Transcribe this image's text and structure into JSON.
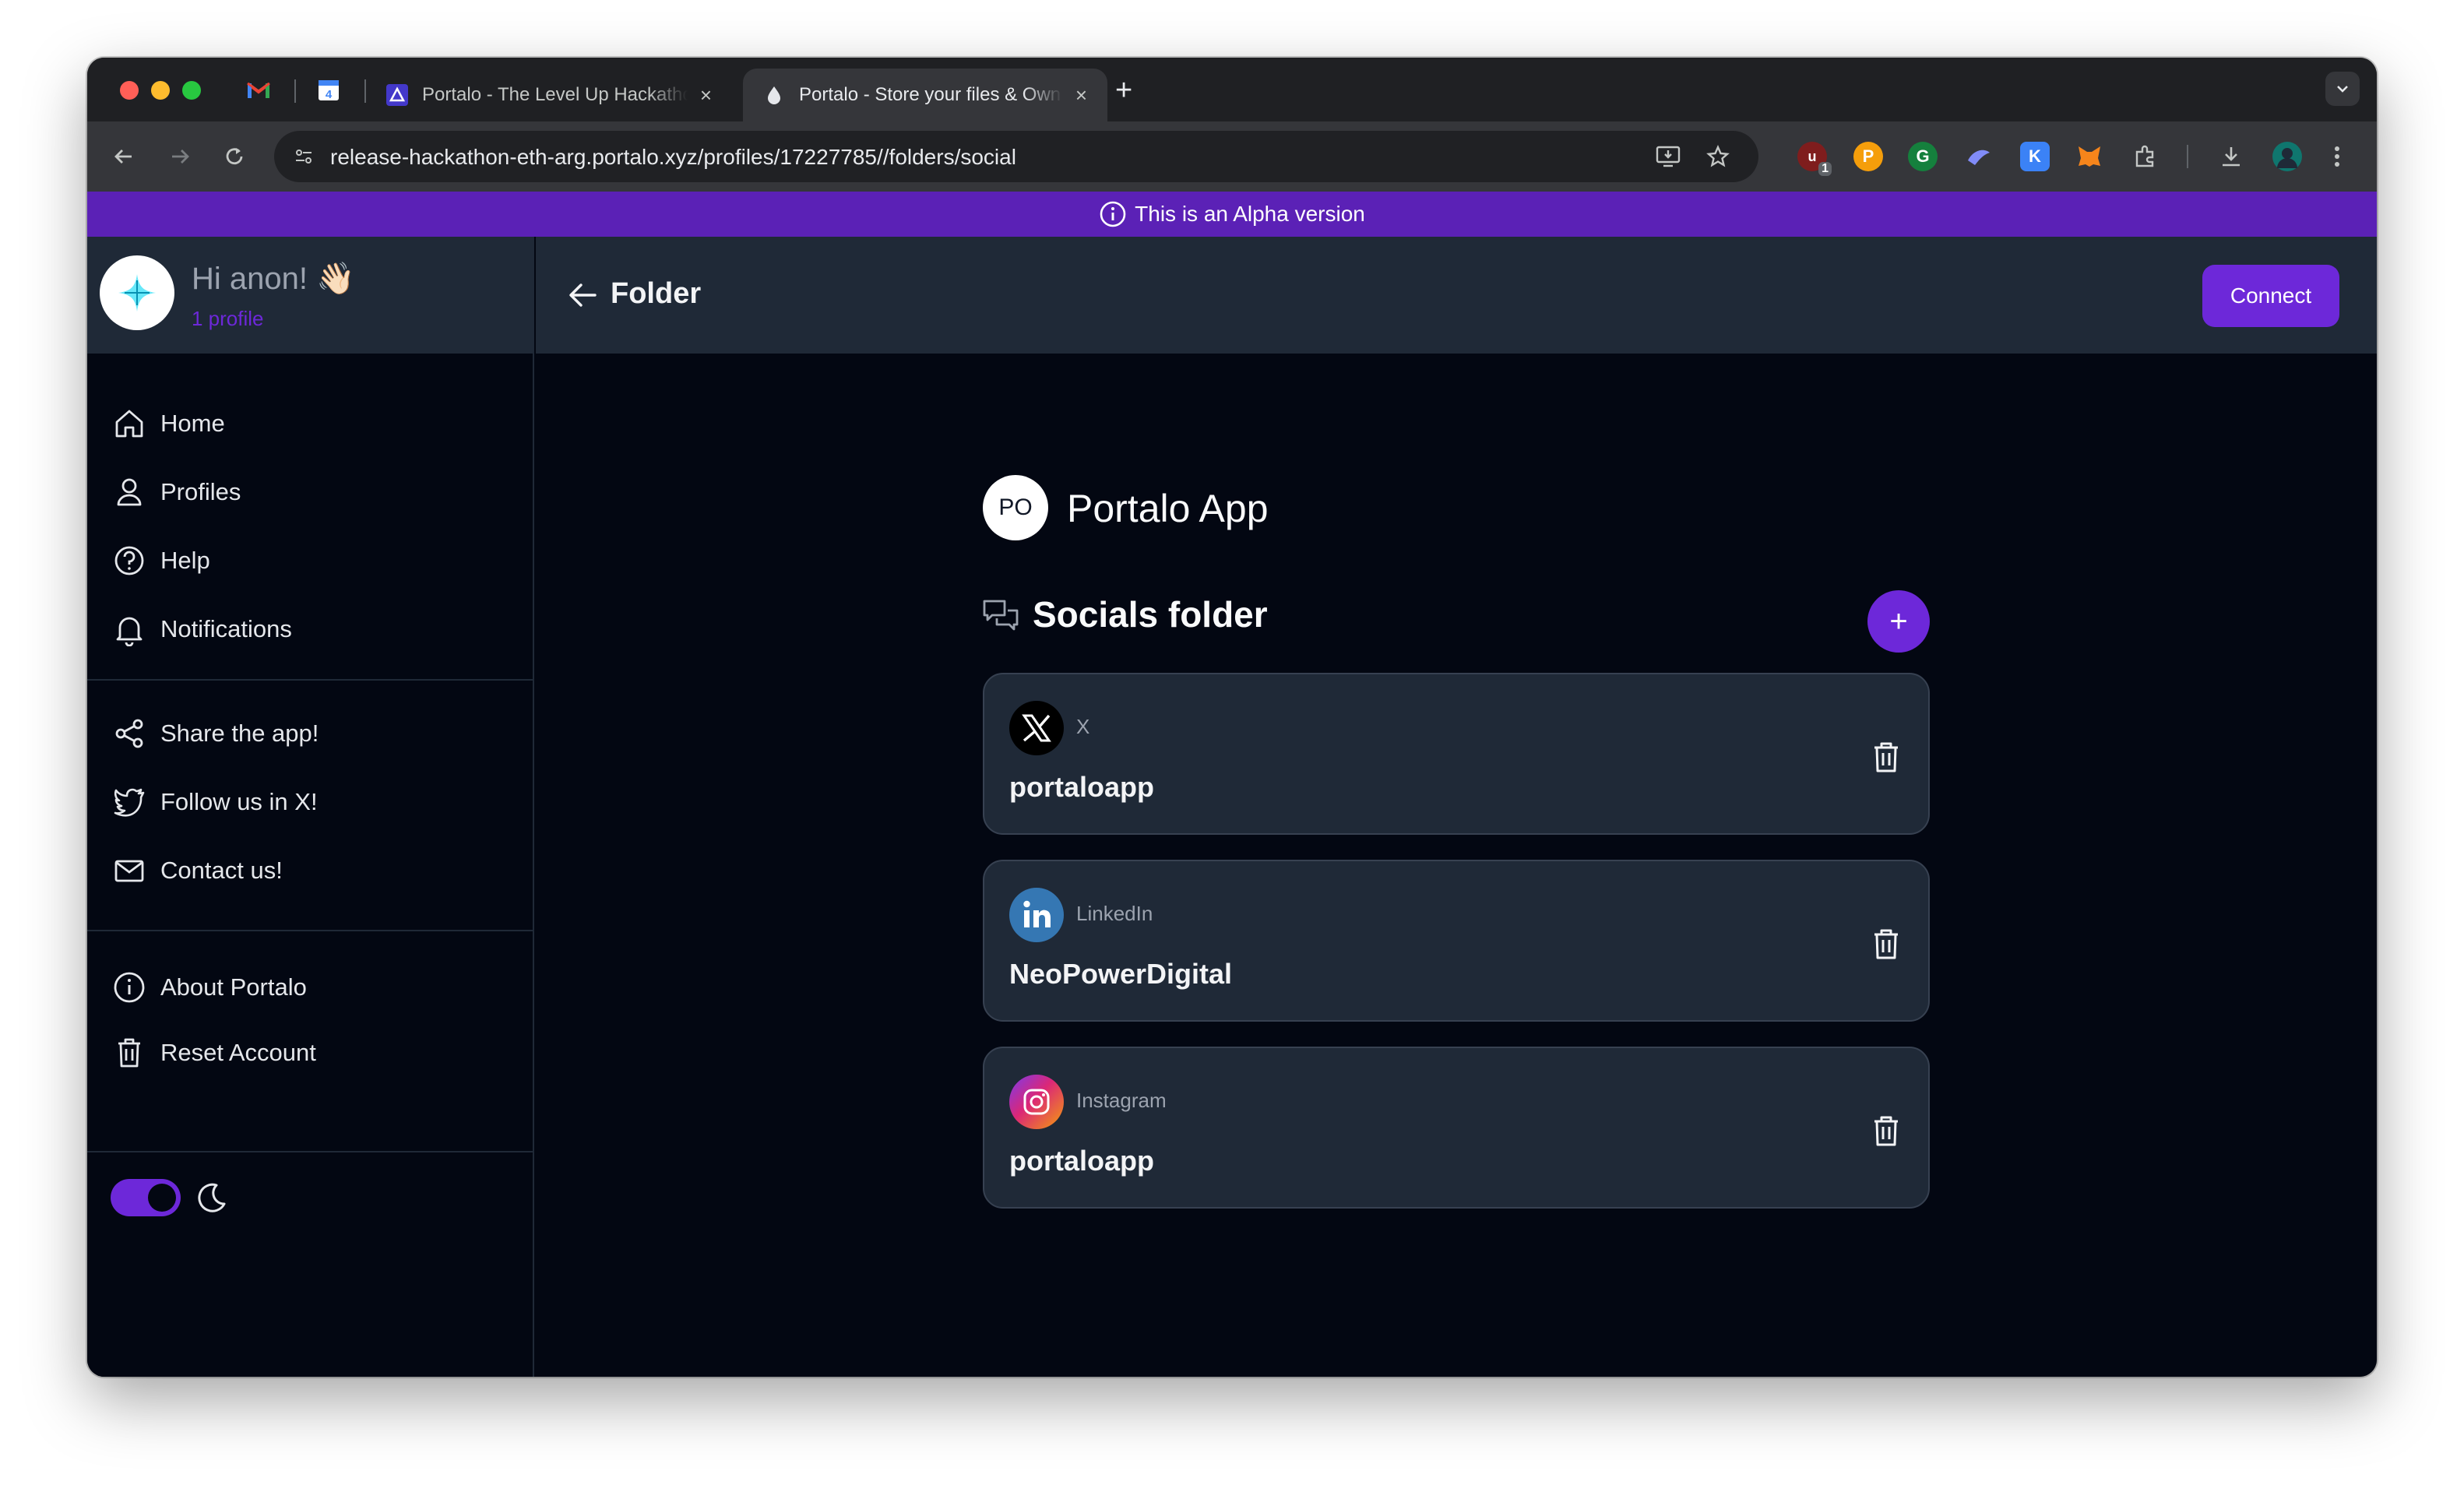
{
  "browser": {
    "tabs": [
      {
        "title": "Portalo - The Level Up Hackathon",
        "close": "×"
      },
      {
        "title": "Portalo - Store your files & Own your data",
        "close": "×"
      }
    ],
    "new_tab": "+",
    "url": "release-hackathon-eth-arg.portalo.xyz/profiles/17227785//folders/social",
    "extension_badge": "1"
  },
  "banner": {
    "text": "This is an Alpha version"
  },
  "sidebar": {
    "greeting": "Hi anon! 👋🏻",
    "profile_count": "1 profile",
    "main_nav": [
      {
        "label": "Home",
        "icon": "home-icon"
      },
      {
        "label": "Profiles",
        "icon": "user-icon"
      },
      {
        "label": "Help",
        "icon": "help-icon"
      },
      {
        "label": "Notifications",
        "icon": "bell-icon"
      }
    ],
    "social_nav": [
      {
        "label": "Share the app!",
        "icon": "share-icon"
      },
      {
        "label": "Follow us in X!",
        "icon": "twitter-icon"
      },
      {
        "label": "Contact us!",
        "icon": "mail-icon"
      }
    ],
    "account_nav": [
      {
        "label": "About Portalo",
        "icon": "info-icon"
      },
      {
        "label": "Reset Account",
        "icon": "trash-icon"
      }
    ],
    "theme_toggle": {
      "dark_mode": true
    }
  },
  "header": {
    "title": "Folder",
    "connect_label": "Connect"
  },
  "main": {
    "profile_initials": "PO",
    "profile_name": "Portalo App",
    "folder_title": "Socials folder",
    "add_label": "+",
    "socials": [
      {
        "network": "X",
        "handle": "portaloapp",
        "icon": "x-logo-icon"
      },
      {
        "network": "LinkedIn",
        "handle": "NeoPowerDigital",
        "icon": "linkedin-logo-icon"
      },
      {
        "network": "Instagram",
        "handle": "portaloapp",
        "icon": "instagram-logo-icon"
      }
    ]
  },
  "colors": {
    "accent": "#6d28d9",
    "banner": "#5b21b6",
    "surface": "#1f2937",
    "background": "#030712"
  }
}
